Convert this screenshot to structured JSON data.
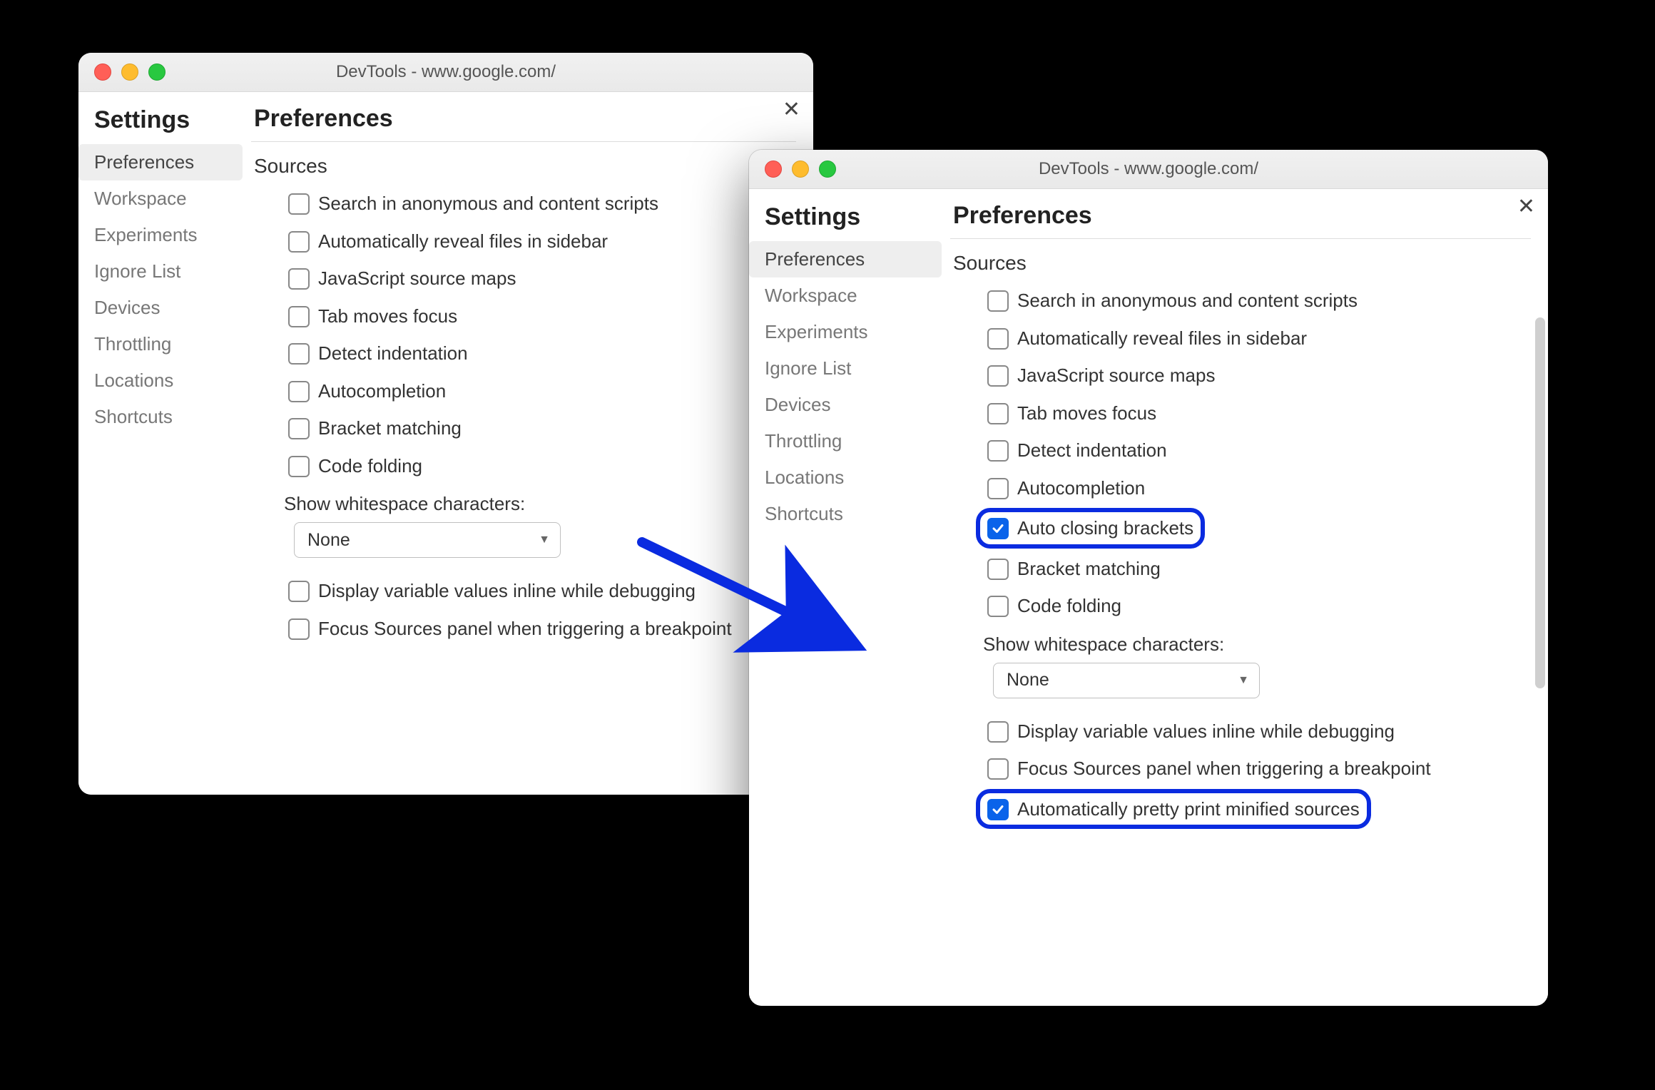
{
  "colors": {
    "accent": "#0a63ea",
    "highlight_border": "#0a2be0"
  },
  "left_window": {
    "title": "DevTools - www.google.com/",
    "settings_title": "Settings",
    "main_title": "Preferences",
    "section_title": "Sources",
    "nav": [
      {
        "label": "Preferences",
        "active": true
      },
      {
        "label": "Workspace",
        "active": false
      },
      {
        "label": "Experiments",
        "active": false
      },
      {
        "label": "Ignore List",
        "active": false
      },
      {
        "label": "Devices",
        "active": false
      },
      {
        "label": "Throttling",
        "active": false
      },
      {
        "label": "Locations",
        "active": false
      },
      {
        "label": "Shortcuts",
        "active": false
      }
    ],
    "options": [
      {
        "label": "Search in anonymous and content scripts",
        "checked": false,
        "highlight": false
      },
      {
        "label": "Automatically reveal files in sidebar",
        "checked": false,
        "highlight": false
      },
      {
        "label": "JavaScript source maps",
        "checked": false,
        "highlight": false
      },
      {
        "label": "Tab moves focus",
        "checked": false,
        "highlight": false
      },
      {
        "label": "Detect indentation",
        "checked": false,
        "highlight": false
      },
      {
        "label": "Autocompletion",
        "checked": false,
        "highlight": false
      },
      {
        "label": "Bracket matching",
        "checked": false,
        "highlight": false
      },
      {
        "label": "Code folding",
        "checked": false,
        "highlight": false
      }
    ],
    "whitespace_label": "Show whitespace characters:",
    "whitespace_value": "None",
    "trailing_options": [
      {
        "label": "Display variable values inline while debugging",
        "checked": false,
        "highlight": false
      },
      {
        "label": "Focus Sources panel when triggering a breakpoint",
        "checked": false,
        "highlight": false
      }
    ]
  },
  "right_window": {
    "title": "DevTools - www.google.com/",
    "settings_title": "Settings",
    "main_title": "Preferences",
    "section_title": "Sources",
    "nav": [
      {
        "label": "Preferences",
        "active": true
      },
      {
        "label": "Workspace",
        "active": false
      },
      {
        "label": "Experiments",
        "active": false
      },
      {
        "label": "Ignore List",
        "active": false
      },
      {
        "label": "Devices",
        "active": false
      },
      {
        "label": "Throttling",
        "active": false
      },
      {
        "label": "Locations",
        "active": false
      },
      {
        "label": "Shortcuts",
        "active": false
      }
    ],
    "options": [
      {
        "label": "Search in anonymous and content scripts",
        "checked": false,
        "highlight": false
      },
      {
        "label": "Automatically reveal files in sidebar",
        "checked": false,
        "highlight": false
      },
      {
        "label": "JavaScript source maps",
        "checked": false,
        "highlight": false
      },
      {
        "label": "Tab moves focus",
        "checked": false,
        "highlight": false
      },
      {
        "label": "Detect indentation",
        "checked": false,
        "highlight": false
      },
      {
        "label": "Autocompletion",
        "checked": false,
        "highlight": false
      },
      {
        "label": "Auto closing brackets",
        "checked": true,
        "highlight": true
      },
      {
        "label": "Bracket matching",
        "checked": false,
        "highlight": false
      },
      {
        "label": "Code folding",
        "checked": false,
        "highlight": false
      }
    ],
    "whitespace_label": "Show whitespace characters:",
    "whitespace_value": "None",
    "trailing_options": [
      {
        "label": "Display variable values inline while debugging",
        "checked": false,
        "highlight": false
      },
      {
        "label": "Focus Sources panel when triggering a breakpoint",
        "checked": false,
        "highlight": false
      },
      {
        "label": "Automatically pretty print minified sources",
        "checked": true,
        "highlight": true
      }
    ]
  }
}
